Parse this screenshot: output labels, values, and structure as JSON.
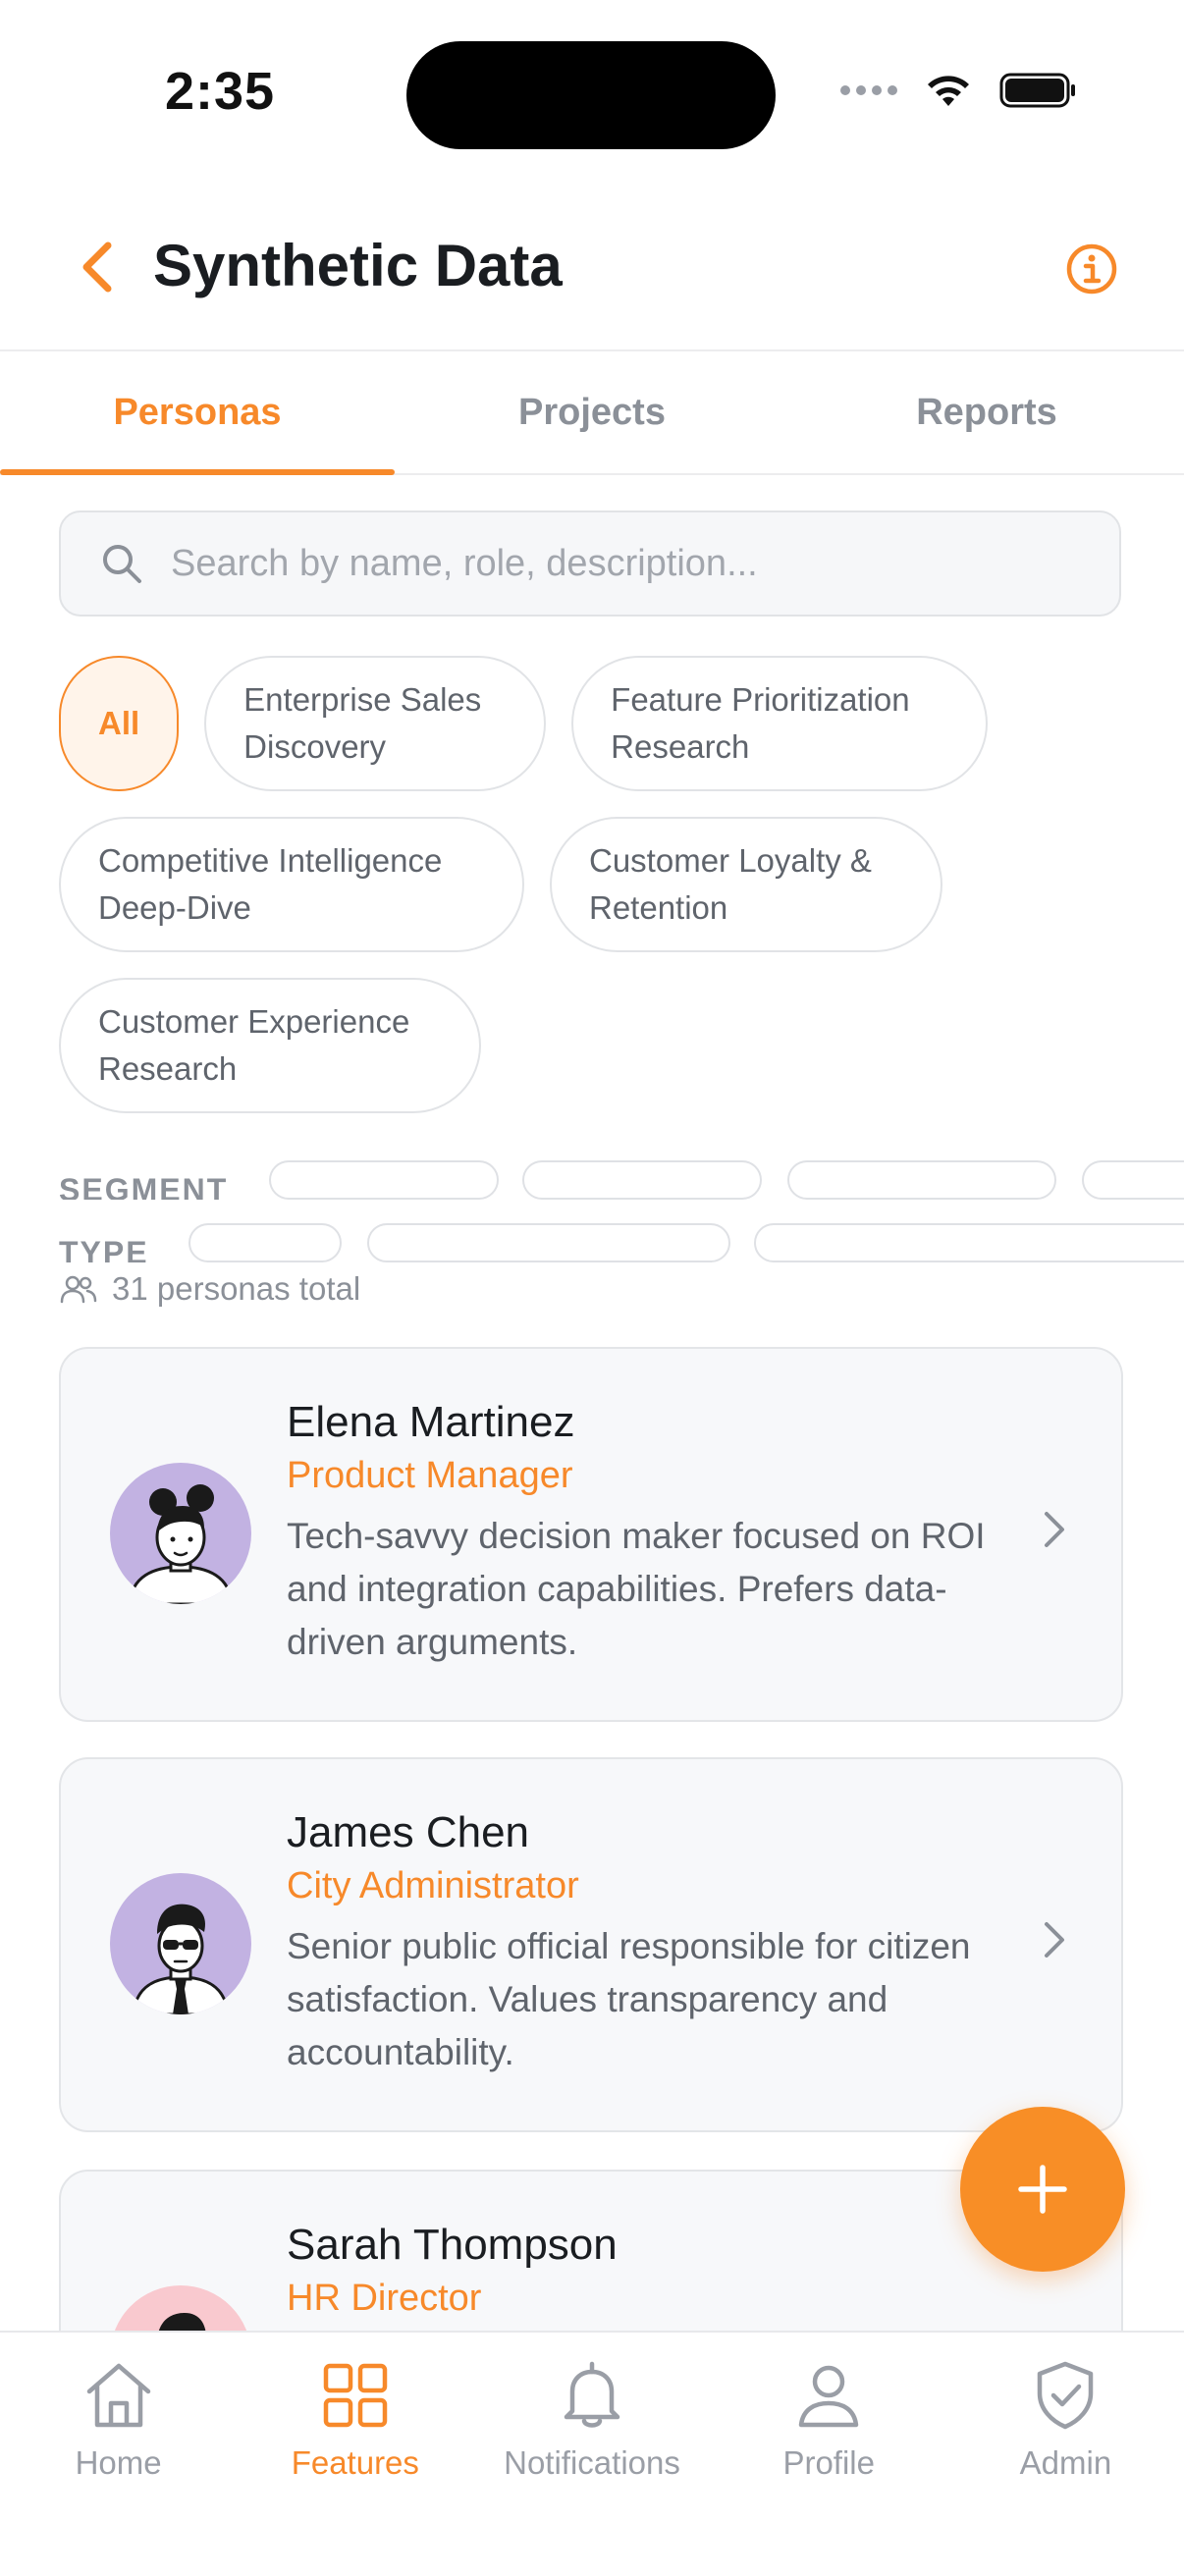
{
  "status_bar": {
    "time": "2:35"
  },
  "header": {
    "title": "Synthetic Data"
  },
  "tabs": [
    {
      "label": "Personas",
      "active": true
    },
    {
      "label": "Projects",
      "active": false
    },
    {
      "label": "Reports",
      "active": false
    }
  ],
  "search": {
    "placeholder": "Search by name, role, description...",
    "value": ""
  },
  "chips": [
    {
      "label": "All",
      "active": true
    },
    {
      "label": "Enterprise Sales Discovery",
      "active": false
    },
    {
      "label": "Feature Prioritization Research",
      "active": false
    },
    {
      "label": "Competitive Intelligence Deep-Dive",
      "active": false
    },
    {
      "label": "Customer Loyalty & Retention",
      "active": false
    },
    {
      "label": "Customer Experience Research",
      "active": false
    }
  ],
  "filters": {
    "segment_label": "SEGMENT",
    "type_label": "TYPE"
  },
  "total": "31 personas total",
  "personas": [
    {
      "name": "Elena Martinez",
      "role": "Product Manager",
      "description": "Tech-savvy decision maker focused on ROI and integration capabilities. Prefers data-driven arguments.",
      "avatar_bg": "#c2b2e2"
    },
    {
      "name": "James Chen",
      "role": "City Administrator",
      "description": "Senior public official responsible for citizen satisfaction. Values transparency and accountability.",
      "avatar_bg": "#c2b2e2"
    },
    {
      "name": "Sarah Thompson",
      "role": "HR Director",
      "description": "",
      "avatar_bg": "#f9c9cf"
    }
  ],
  "nav": [
    {
      "label": "Home",
      "icon": "home-icon",
      "active": false
    },
    {
      "label": "Features",
      "icon": "grid-icon",
      "active": true
    },
    {
      "label": "Notifications",
      "icon": "bell-icon",
      "active": false
    },
    {
      "label": "Profile",
      "icon": "person-icon",
      "active": false
    },
    {
      "label": "Admin",
      "icon": "shield-check-icon",
      "active": false
    }
  ],
  "colors": {
    "accent": "#f7892a",
    "muted_text": "#8b9098",
    "card_bg": "#f7f8fa"
  }
}
